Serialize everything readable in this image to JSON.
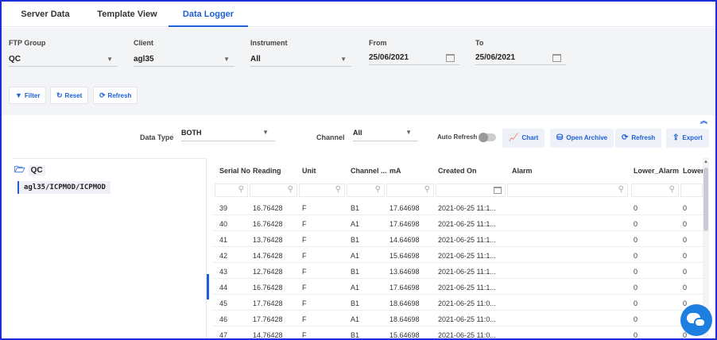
{
  "tabs": [
    "Server Data",
    "Template View",
    "Data Logger"
  ],
  "filters": {
    "ftp_group": {
      "label": "FTP Group",
      "value": "QC"
    },
    "client": {
      "label": "Client",
      "value": "agl35"
    },
    "instrument": {
      "label": "Instrument",
      "value": "All"
    },
    "from": {
      "label": "From",
      "value": "25/06/2021"
    },
    "to": {
      "label": "To",
      "value": "25/06/2021"
    }
  },
  "filter_buttons": {
    "filter": "Filter",
    "reset": "Reset",
    "refresh": "Refresh"
  },
  "toolbar": {
    "data_type_label": "Data Type",
    "data_type_value": "BOTH",
    "channel_label": "Channel",
    "channel_value": "All",
    "auto_refresh_label": "Auto Refresh",
    "chart": "Chart",
    "open_archive": "Open Archive",
    "refresh": "Refresh",
    "export": "Export"
  },
  "tree": {
    "root": "QC",
    "child": "agl35/ICPMOD/ICPMOD"
  },
  "columns": [
    "Serial No",
    "Reading",
    "Unit",
    "Channel ...",
    "mA",
    "Created On",
    "Alarm",
    "Lower_Alarm",
    "Lower_"
  ],
  "rows": [
    [
      "39",
      "16.76428",
      "F",
      "B1",
      "17.64698",
      "2021-06-25 11:1...",
      "",
      "0",
      "0"
    ],
    [
      "40",
      "16.76428",
      "F",
      "A1",
      "17.64698",
      "2021-06-25 11:1...",
      "",
      "0",
      "0"
    ],
    [
      "41",
      "13.76428",
      "F",
      "B1",
      "14.64698",
      "2021-06-25 11:1...",
      "",
      "0",
      "0"
    ],
    [
      "42",
      "14.76428",
      "F",
      "A1",
      "15.64698",
      "2021-06-25 11:1...",
      "",
      "0",
      "0"
    ],
    [
      "43",
      "12.76428",
      "F",
      "B1",
      "13.64698",
      "2021-06-25 11:1...",
      "",
      "0",
      "0"
    ],
    [
      "44",
      "16.76428",
      "F",
      "A1",
      "17.64698",
      "2021-06-25 11:1...",
      "",
      "0",
      "0"
    ],
    [
      "45",
      "17.76428",
      "F",
      "B1",
      "18.64698",
      "2021-06-25 11:0...",
      "",
      "0",
      "0"
    ],
    [
      "46",
      "17.76428",
      "F",
      "A1",
      "18.64698",
      "2021-06-25 11:0...",
      "",
      "0",
      "0"
    ],
    [
      "47",
      "14.76428",
      "F",
      "B1",
      "15.64698",
      "2021-06-25 11:0...",
      "",
      "0",
      "0"
    ]
  ],
  "colors": {
    "accent": "#1d5fd6",
    "frame": "#1a2fd6",
    "filter_bg": "#f3f4f6"
  }
}
